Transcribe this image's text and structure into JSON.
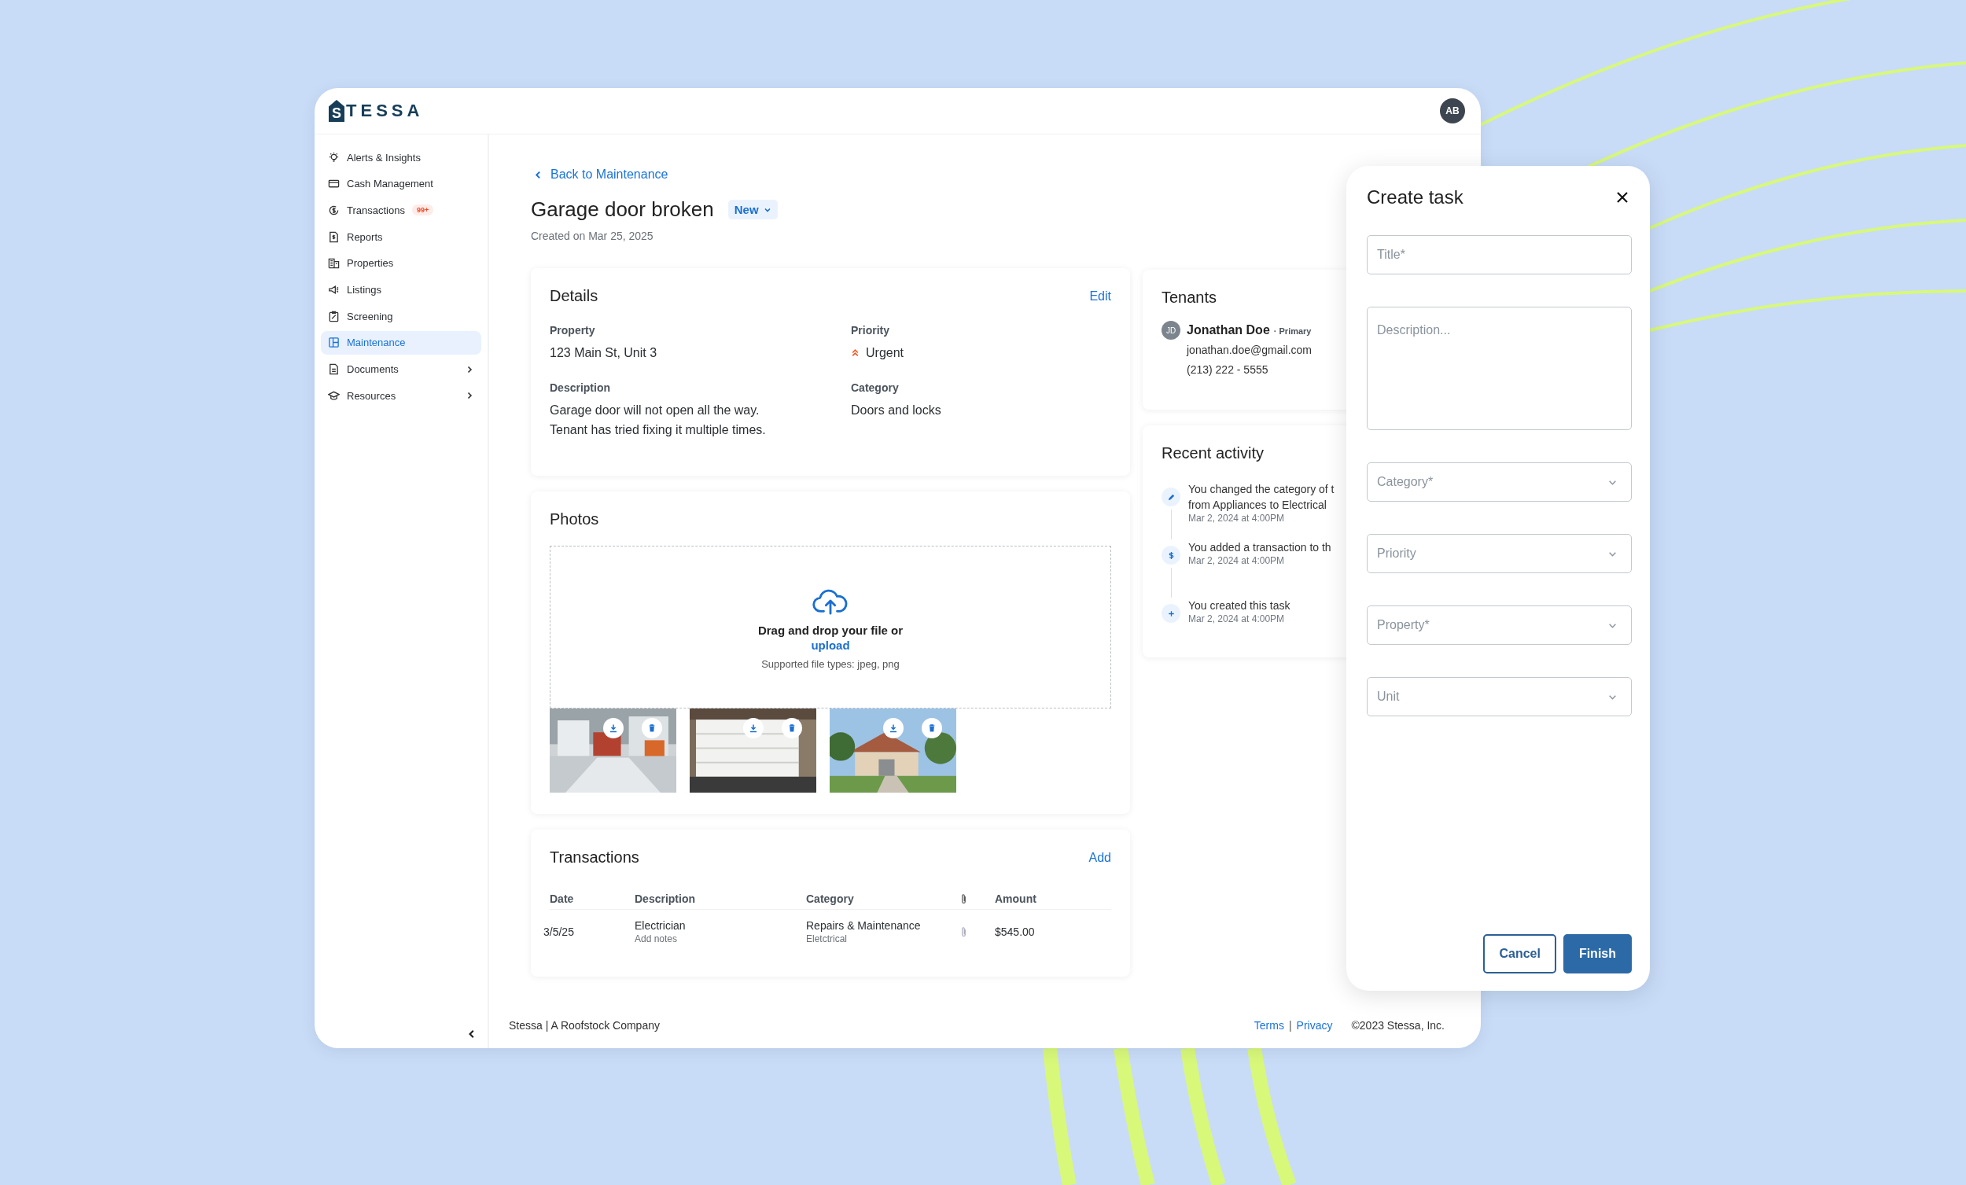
{
  "header": {
    "logo": {
      "mark": "S",
      "text": "TESSA"
    },
    "avatar": "AB"
  },
  "sidebar": {
    "items": [
      {
        "label": "Alerts & Insights",
        "selected": false,
        "has_submenu": false
      },
      {
        "label": "Cash Management",
        "selected": false,
        "has_submenu": false
      },
      {
        "label": "Transactions",
        "selected": false,
        "has_submenu": false,
        "badge": "99+"
      },
      {
        "label": "Reports",
        "selected": false,
        "has_submenu": false
      },
      {
        "label": "Properties",
        "selected": false,
        "has_submenu": false
      },
      {
        "label": "Listings",
        "selected": false,
        "has_submenu": false
      },
      {
        "label": "Screening",
        "selected": false,
        "has_submenu": false
      },
      {
        "label": "Maintenance",
        "selected": true,
        "has_submenu": false
      },
      {
        "label": "Documents",
        "selected": false,
        "has_submenu": true
      },
      {
        "label": "Resources",
        "selected": false,
        "has_submenu": true
      }
    ]
  },
  "page": {
    "back_link": "Back to Maintenance",
    "title": "Garage door broken",
    "status": "New",
    "created": "Created on Mar 25, 2025"
  },
  "details": {
    "title": "Details",
    "action": "Edit",
    "fields": [
      {
        "label": "Property",
        "kind": "text",
        "lines": [
          "123 Main St, Unit 3"
        ]
      },
      {
        "label": "Priority",
        "kind": "priority",
        "lines": [
          "Urgent"
        ]
      },
      {
        "label": "Description",
        "kind": "text",
        "lines": [
          "Garage door will not open all the way.",
          "Tenant has tried fixing it multiple times."
        ]
      },
      {
        "label": "Category",
        "kind": "text",
        "lines": [
          "Doors and locks"
        ]
      }
    ]
  },
  "photos": {
    "title": "Photos",
    "upload": {
      "prompt": "Drag and drop your file or",
      "link": "upload",
      "hint": "Supported file types: jpeg, png"
    }
  },
  "transactions": {
    "title": "Transactions",
    "action": "Add",
    "columns": [
      "Date",
      "Description",
      "Category",
      "Amount"
    ],
    "rows": [
      {
        "date": "3/5/25",
        "description": "Electrician",
        "note": "Add notes",
        "category": "Repairs & Maintenance",
        "subcategory": "Eletctrical",
        "amount": "$545.00"
      }
    ]
  },
  "tenants": {
    "title": "Tenants",
    "tenant": {
      "initials": "JD",
      "name": "Jonathan Doe",
      "role": "· Primary",
      "email": "jonathan.doe@gmail.com",
      "phone": "(213) 222 - 5555"
    }
  },
  "activity": {
    "title": "Recent activity",
    "items": [
      {
        "kind": "edit",
        "lines": [
          "You changed the category of t",
          "from Appliances to Electrical"
        ],
        "time": "Mar 2, 2024 at 4:00PM"
      },
      {
        "kind": "money",
        "lines": [
          "You added a transaction to th"
        ],
        "time": "Mar 2, 2024 at 4:00PM"
      },
      {
        "kind": "create",
        "lines": [
          "You created this task"
        ],
        "time": "Mar 2, 2024 at 4:00PM"
      }
    ]
  },
  "footer": {
    "company": "Stessa | A Roofstock Company",
    "links": [
      "Terms",
      "Privacy"
    ],
    "separator": "|",
    "copyright": "©2023 Stessa, Inc."
  },
  "dialog": {
    "title": "Create task",
    "fields": [
      {
        "kind": "input",
        "placeholder": "Title*"
      },
      {
        "kind": "textarea",
        "placeholder": "Description..."
      },
      {
        "kind": "select",
        "placeholder": "Category*"
      },
      {
        "kind": "select",
        "placeholder": "Priority"
      },
      {
        "kind": "select",
        "placeholder": "Property*"
      },
      {
        "kind": "select",
        "placeholder": "Unit"
      }
    ],
    "buttons": [
      {
        "label": "Cancel",
        "kind": "secondary"
      },
      {
        "label": "Finish",
        "kind": "primary"
      }
    ]
  }
}
